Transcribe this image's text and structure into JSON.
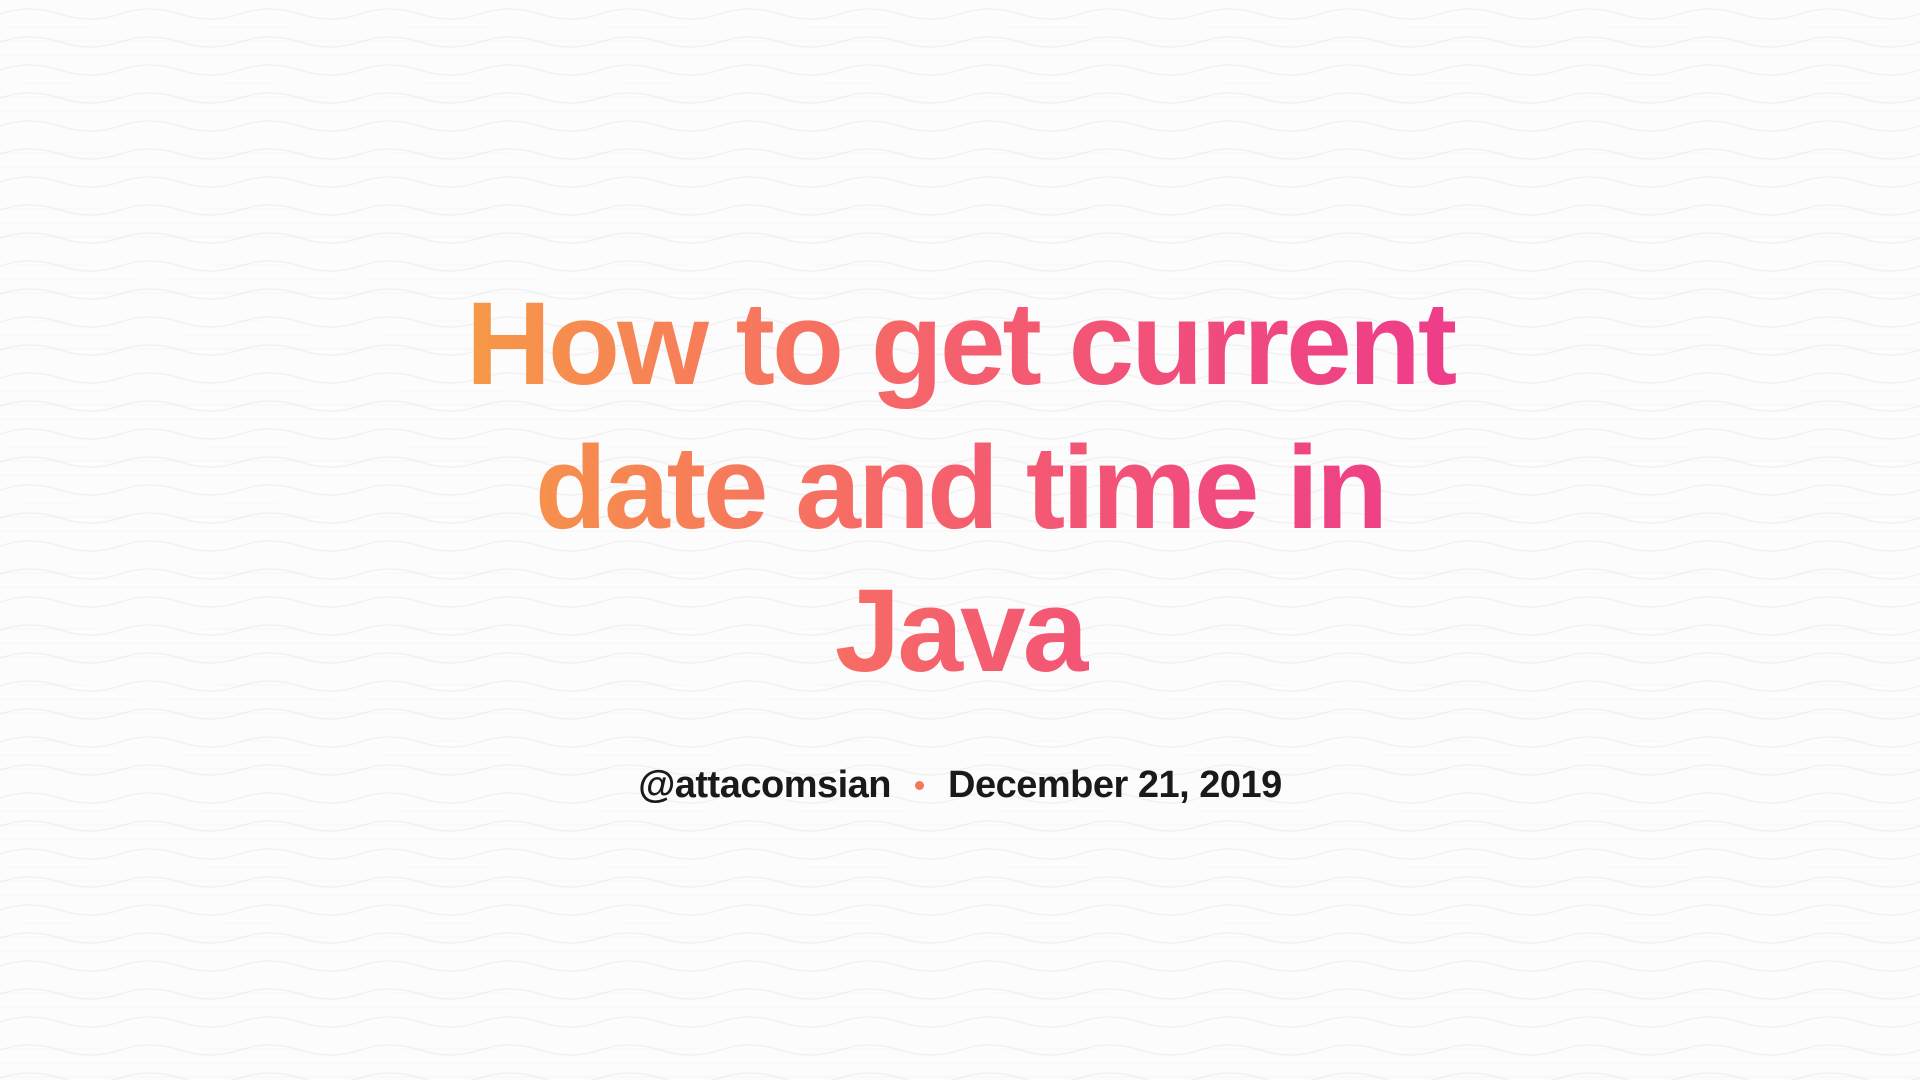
{
  "title": "How to get current date and time in Java",
  "author_handle": "@attacomsian",
  "date": "December 21, 2019"
}
